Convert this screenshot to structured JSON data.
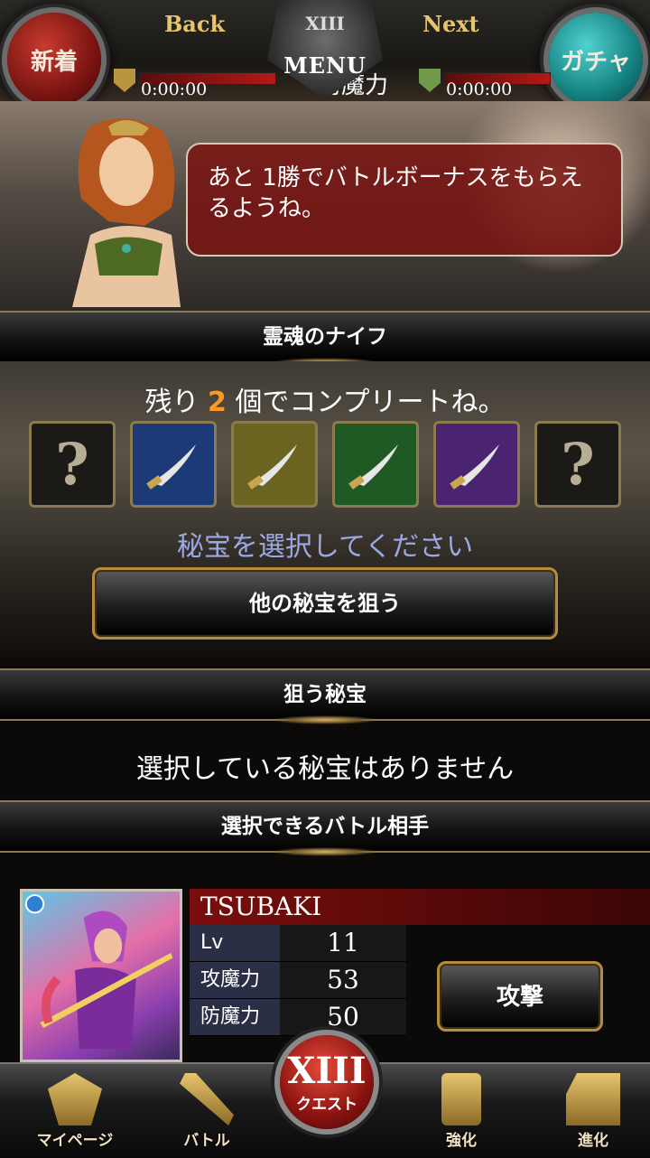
{
  "header": {
    "new_label": "新着",
    "gacha_label": "ガチャ",
    "back_label": "Back",
    "next_label": "Next",
    "menu_label": "MENU",
    "menu_numeral": "XIII",
    "stat_label": "防魔力",
    "left_timer": "0:00:00",
    "right_timer": "0:00:00"
  },
  "speech": {
    "text": "あと 1勝でバトルボーナスをもらえるようね。"
  },
  "treasure_section": {
    "title": "霊魂のナイフ",
    "remaining_prefix": "残り",
    "remaining_count": "2",
    "remaining_suffix": "個でコンプリートね。",
    "slots": [
      {
        "type": "unknown",
        "symbol": "?"
      },
      {
        "type": "knife",
        "color": "#1d3a78"
      },
      {
        "type": "knife",
        "color": "#6a6420"
      },
      {
        "type": "knife",
        "color": "#1f5a24"
      },
      {
        "type": "knife",
        "color": "#4a2470"
      },
      {
        "type": "unknown",
        "symbol": "?"
      }
    ],
    "prompt": "秘宝を選択してください",
    "other_button": "他の秘宝を狙う"
  },
  "target_section": {
    "title": "狙う秘宝",
    "empty_text": "選択している秘宝はありません"
  },
  "opponent_section": {
    "title": "選択できるバトル相手",
    "opponent": {
      "name": "TSUBAKI",
      "stats": [
        {
          "label": "Lv",
          "value": "11"
        },
        {
          "label": "攻魔力",
          "value": "53"
        },
        {
          "label": "防魔力",
          "value": "50"
        }
      ],
      "attack_button": "攻撃"
    }
  },
  "bottom_nav": {
    "items": [
      {
        "label": "マイページ"
      },
      {
        "label": "バトル"
      },
      {
        "label": "クエスト",
        "numeral": "XIII"
      },
      {
        "label": "強化"
      },
      {
        "label": "進化"
      }
    ]
  },
  "colors": {
    "accent_gold": "#b38c42",
    "remaining_highlight": "#ff9a20",
    "prompt_text": "#9aa8e6",
    "speech_bg": "#781412"
  }
}
